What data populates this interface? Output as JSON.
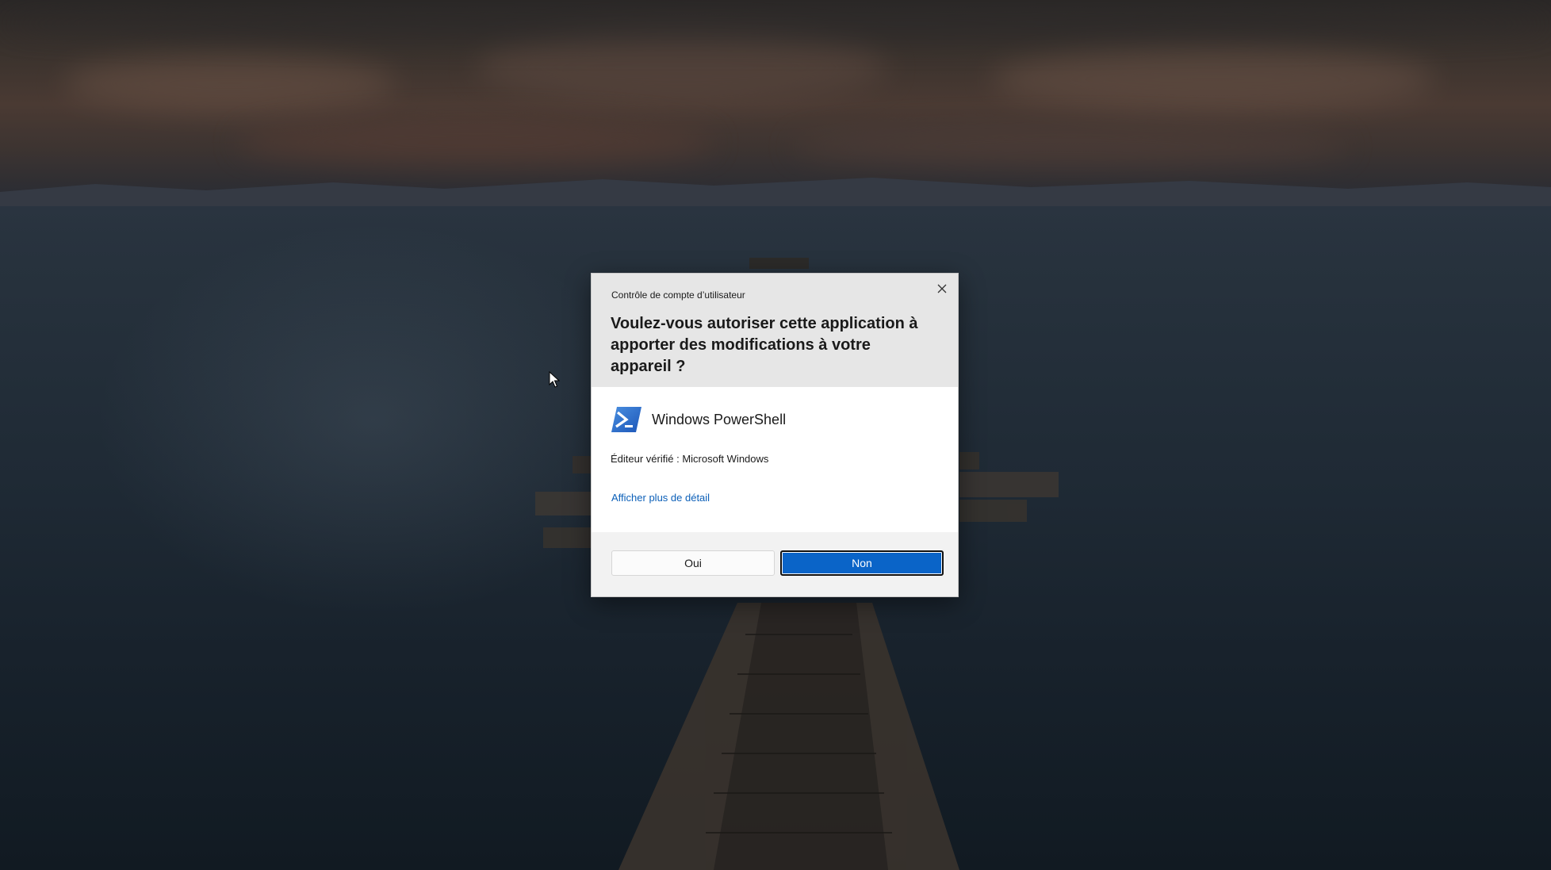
{
  "dialog": {
    "title": "Contrôle de compte d’utilisateur",
    "question": "Voulez-vous autoriser cette application à apporter des modifications à votre appareil ?",
    "app_name": "Windows PowerShell",
    "app_icon": "powershell-icon",
    "publisher": "Éditeur vérifié : Microsoft Windows",
    "details_link": "Afficher plus de détail",
    "close_icon": "close-icon",
    "buttons": {
      "yes": "Oui",
      "no": "Non"
    }
  },
  "colors": {
    "header_bg": "#e6e6e6",
    "footer_bg": "#f2f2f2",
    "primary_button": "#0a64c8",
    "link": "#0b5fb8"
  },
  "cursor_icon": "mouse-pointer-icon"
}
